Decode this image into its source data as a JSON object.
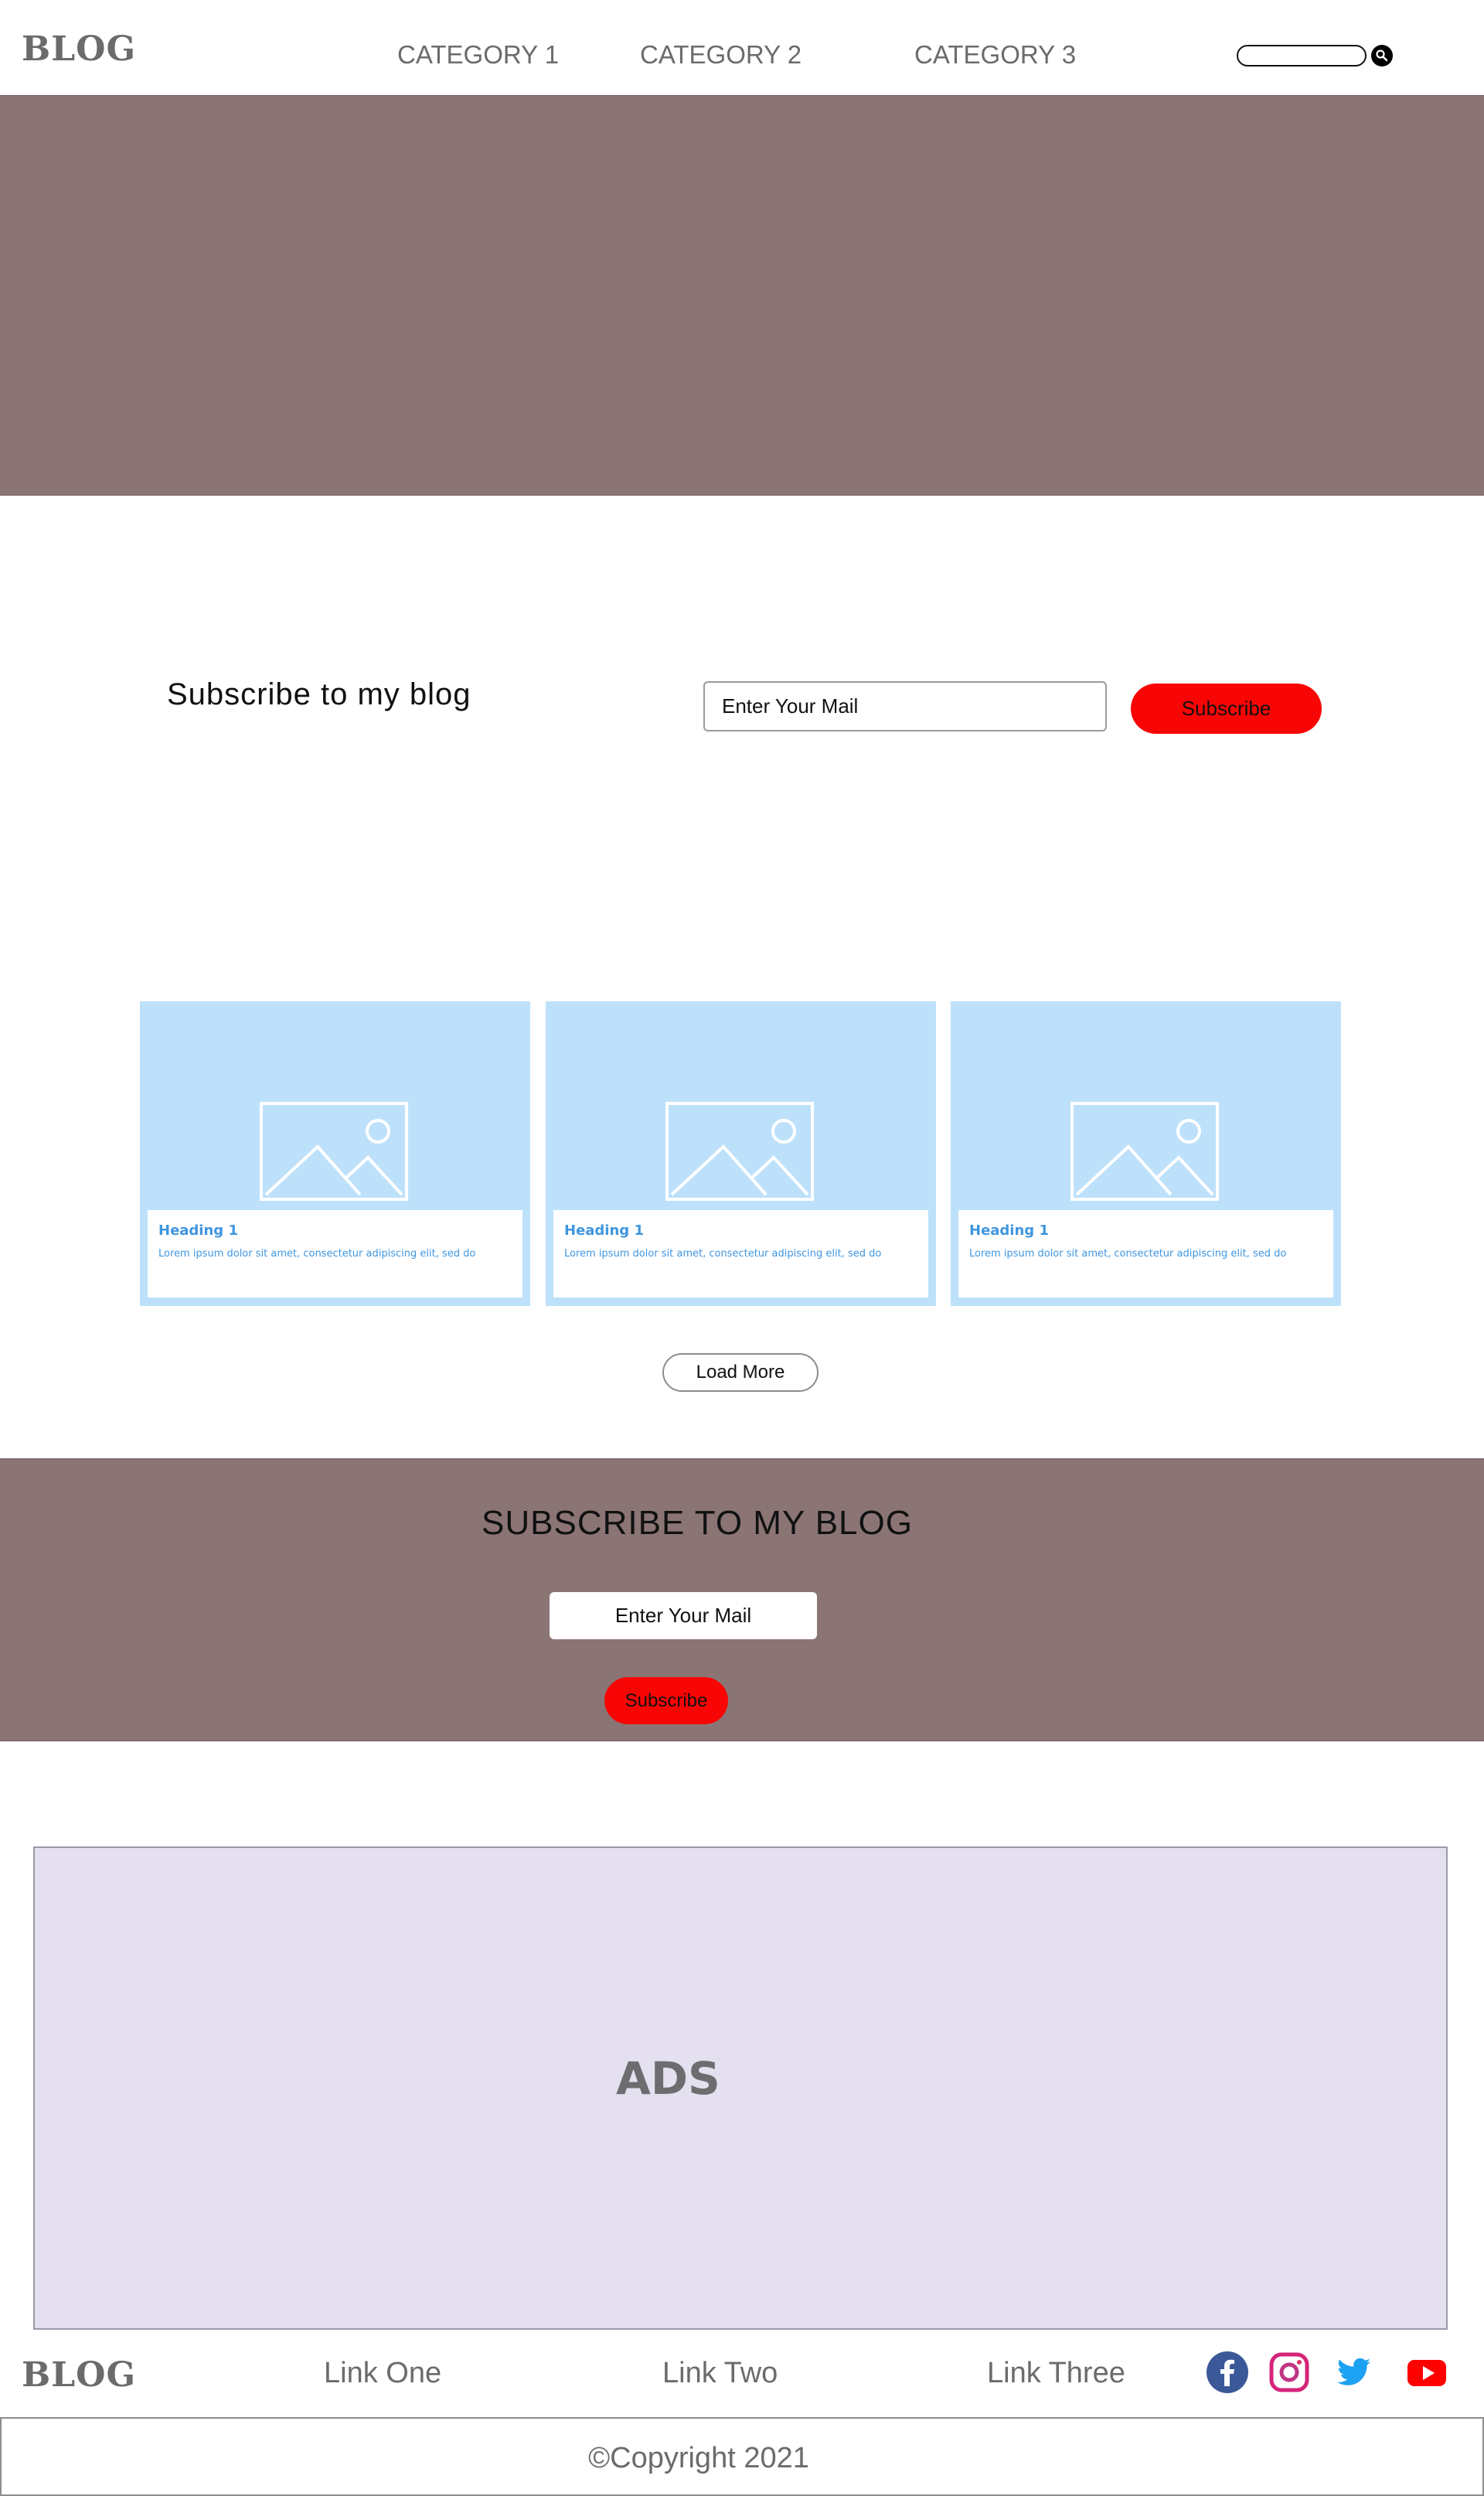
{
  "header": {
    "logo": "BLOG",
    "nav": [
      "CATEGORY 1",
      "CATEGORY 2",
      "CATEGORY 3"
    ],
    "search": {
      "placeholder": "",
      "icon": "search-icon"
    }
  },
  "subscribe": {
    "title": "Subscribe to my blog",
    "input_placeholder": "Enter Your Mail",
    "button": "Subscribe"
  },
  "cards": [
    {
      "heading": "Heading 1",
      "text": "Lorem ipsum dolor sit amet, consectetur adipiscing elit, sed do",
      "icon": "image-placeholder-icon"
    },
    {
      "heading": "Heading 1",
      "text": "Lorem ipsum dolor sit amet, consectetur adipiscing elit, sed do",
      "icon": "image-placeholder-icon"
    },
    {
      "heading": "Heading 1",
      "text": "Lorem ipsum dolor sit amet, consectetur adipiscing elit, sed do",
      "icon": "image-placeholder-icon"
    }
  ],
  "load_more": "Load More",
  "band": {
    "title": "SUBSCRIBE TO MY BLOG",
    "input_placeholder": "Enter Your Mail",
    "button": "Subscribe"
  },
  "ads": {
    "label": "ADS"
  },
  "footer": {
    "logo": "BLOG",
    "links": [
      "Link One",
      "Link Two",
      "Link Three"
    ],
    "social": [
      "facebook-icon",
      "instagram-icon",
      "twitter-icon",
      "youtube-icon"
    ],
    "copyright": "©Copyright 2021"
  },
  "colors": {
    "hero_bg": "#8b7574",
    "accent_red": "#f80505",
    "card_bg": "#bee1fb",
    "card_text": "#3f96df",
    "ads_bg": "#e4e0ef"
  }
}
